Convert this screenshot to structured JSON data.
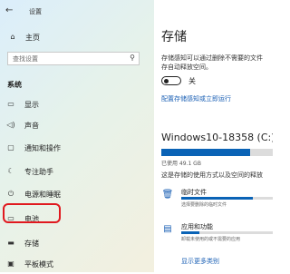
{
  "window": {
    "title": "设置",
    "back_icon": "back-arrow-icon"
  },
  "sidebar": {
    "home_label": "主页",
    "search_placeholder": "查找设置",
    "section_title": "系统",
    "items": [
      {
        "label": "显示",
        "icon": "display-icon",
        "glyph": "▭"
      },
      {
        "label": "声音",
        "icon": "speaker-icon",
        "glyph": "◁)"
      },
      {
        "label": "通知和操作",
        "icon": "notification-icon",
        "glyph": "▢"
      },
      {
        "label": "专注助手",
        "icon": "moon-icon",
        "glyph": "☾"
      },
      {
        "label": "电源和睡眠",
        "icon": "power-icon",
        "glyph": "⏻"
      },
      {
        "label": "电池",
        "icon": "battery-icon",
        "glyph": "▭"
      },
      {
        "label": "存储",
        "icon": "storage-icon",
        "glyph": "▬"
      },
      {
        "label": "平板模式",
        "icon": "tablet-icon",
        "glyph": "▣"
      }
    ],
    "highlight_color": "#e0191f"
  },
  "main": {
    "title": "存储",
    "description_line1": "存储感知可以通过删除不需要的文件",
    "description_line2": "存自动释放空间。",
    "toggle_state": "关",
    "config_link": "配置存储感知或立即运行",
    "drive_name": "Windows10-18358 (C:) -",
    "drive_used_fraction": 0.8,
    "drive_used_label": "已使用 49.1 GB",
    "drive_desc": "这是存储的使用方式以及空间的释放",
    "categories": [
      {
        "name": "临时文件",
        "sub": "选择要删除的临时文件",
        "icon": "trash-icon",
        "glyph": "🗑",
        "fraction": 0.78
      },
      {
        "name": "应用和功能",
        "sub": "卸载未使用的或不需要的应用",
        "icon": "apps-icon",
        "glyph": "▤",
        "fraction": 0.2
      }
    ],
    "more_link": "显示更多类别"
  },
  "colors": {
    "accent": "#0a63b6",
    "link": "#1a5fb4"
  }
}
